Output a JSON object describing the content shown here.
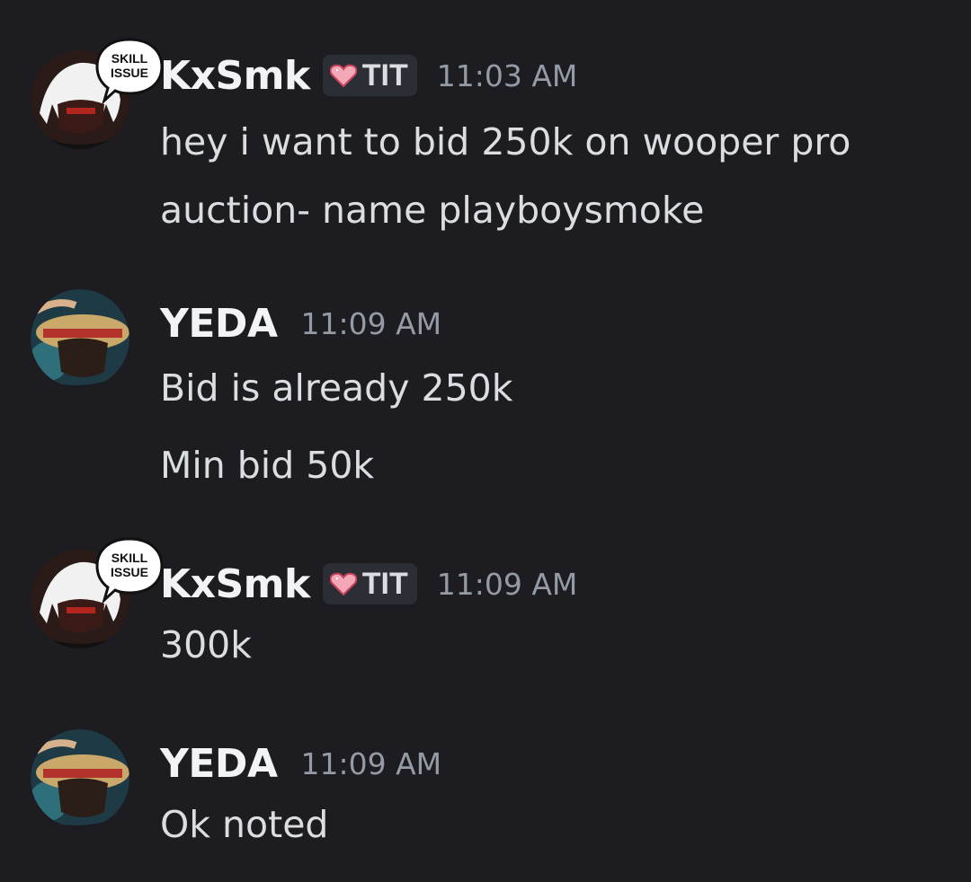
{
  "messages": [
    {
      "author": "KxSmk",
      "tag": "TIT",
      "time": "11:03 AM",
      "decoration_text": "SKILL ISSUE",
      "lines": [
        "hey i want to bid 250k on wooper pro",
        "auction- name playboysmoke"
      ]
    },
    {
      "author": "YEDA",
      "time": "11:09 AM",
      "lines": [
        "Bid is already 250k",
        "Min bid 50k"
      ]
    },
    {
      "author": "KxSmk",
      "tag": "TIT",
      "time": "11:09 AM",
      "decoration_text": "SKILL ISSUE",
      "lines": [
        "300k"
      ]
    },
    {
      "author": "YEDA",
      "time": "11:09 AM",
      "lines": [
        "Ok noted"
      ]
    }
  ],
  "icons": {
    "tag": "heart-icon",
    "avatar_kxsmk": "white-haired-character-avatar",
    "avatar_yeda": "straw-hat-character-avatar"
  },
  "colors": {
    "background": "#1c1c21",
    "text": "#dbdee1",
    "username": "#f2f3f5",
    "timestamp": "#949ba4",
    "tag_background": "#2c2e36",
    "heart": "#f4a7b6"
  }
}
